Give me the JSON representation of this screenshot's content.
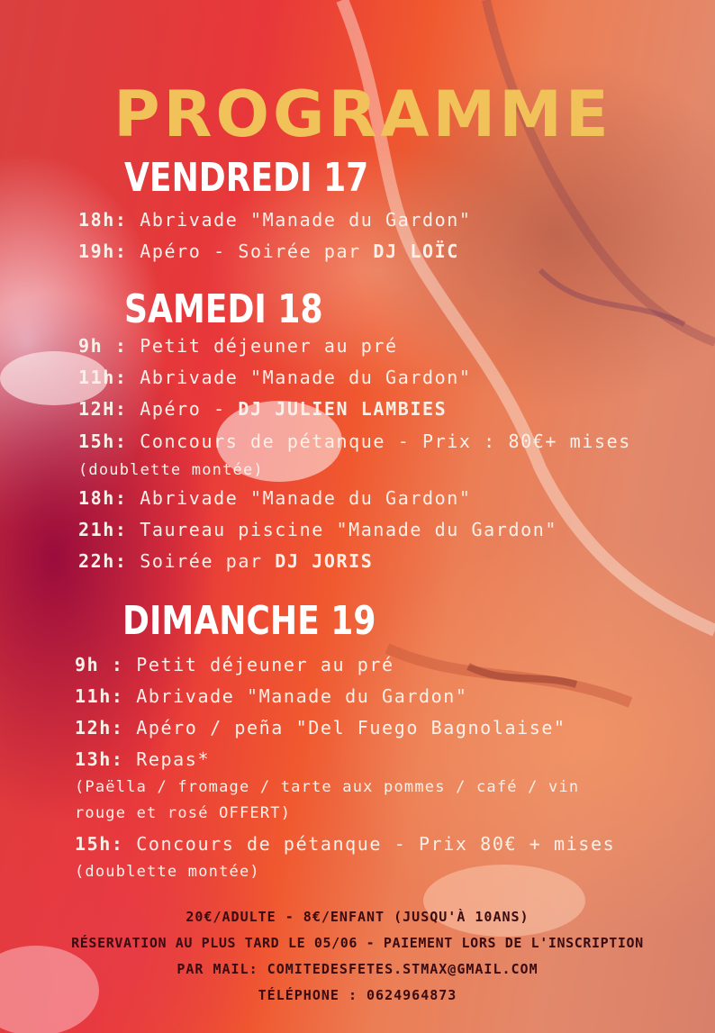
{
  "title": "PROGRAMME",
  "days": [
    {
      "name": "VENDREDI 17",
      "items": [
        {
          "time": "18h:",
          "text": "Abrivade \"Manade du Gardon\"",
          "dj": ""
        },
        {
          "time": "19h:",
          "text": "Apéro - Soirée par ",
          "dj": "DJ LOÏC"
        }
      ]
    },
    {
      "name": "SAMEDI 18",
      "items": [
        {
          "time": "9h :",
          "text": "Petit déjeuner au pré",
          "dj": ""
        },
        {
          "time": "11h:",
          "text": "Abrivade \"Manade du Gardon\"",
          "dj": ""
        },
        {
          "time": "12H:",
          "text": "Apéro - ",
          "dj": "DJ JULIEN LAMBIES"
        },
        {
          "time": "15h:",
          "text": "Concours de pétanque - Prix : 80€+ mises",
          "dj": ""
        },
        {
          "time": "18h:",
          "text": "Abrivade \"Manade du Gardon\"",
          "dj": ""
        },
        {
          "time": "21h:",
          "text": "Taureau piscine \"Manade du Gardon\"",
          "dj": ""
        },
        {
          "time": "22h:",
          "text": "Soirée par ",
          "dj": "DJ JORIS"
        }
      ],
      "note": "(doublette montée)"
    },
    {
      "name": "DIMANCHE 19",
      "items": [
        {
          "time": "9h :",
          "text": "Petit déjeuner au pré",
          "dj": ""
        },
        {
          "time": "11h:",
          "text": "Abrivade \"Manade du Gardon\"",
          "dj": ""
        },
        {
          "time": "12h:",
          "text": "Apéro / peña \"Del Fuego Bagnolaise\"",
          "dj": ""
        },
        {
          "time": "13h:",
          "text": "Repas*",
          "dj": ""
        },
        {
          "time": "15h:",
          "text": "Concours de pétanque - Prix 80€ + mises",
          "dj": ""
        }
      ],
      "repas_note_1": "(Paëlla / fromage / tarte aux pommes / café / vin",
      "repas_note_2": "rouge et rosé OFFERT)",
      "note": "(doublette montée)"
    }
  ],
  "info": {
    "prices": "20€/ADULTE - 8€/ENFANT (JUSQU'À 10ANS)",
    "reservation": "RÉSERVATION AU PLUS TARD LE 05/06 - PAIEMENT LORS DE L'INSCRIPTION",
    "mail": "PAR MAIL: COMITEDESFETES.STMAX@GMAIL.COM",
    "phone": "TÉLÉPHONE : 0624964873"
  },
  "colors": {
    "title": "#f2c25a",
    "text": "#fdf0e8",
    "info": "#3a0b10"
  }
}
